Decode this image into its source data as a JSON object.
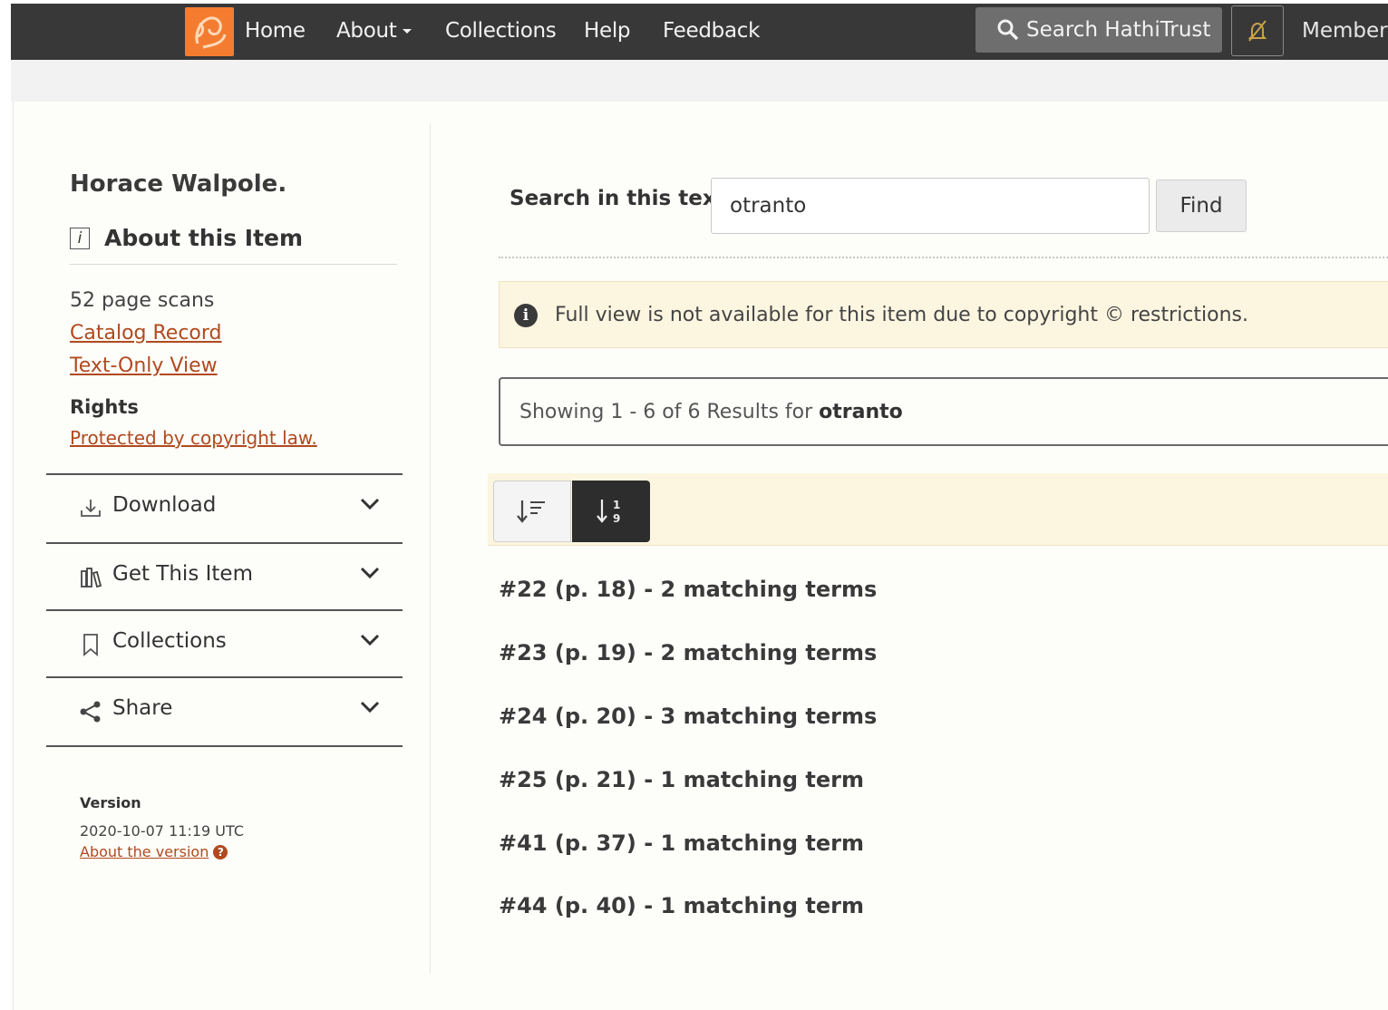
{
  "nav": {
    "home": "Home",
    "about": "About",
    "collections": "Collections",
    "help": "Help",
    "feedback": "Feedback",
    "search_button": "Search HathiTrust",
    "member": "Member"
  },
  "sidebar": {
    "author": "Horace Walpole.",
    "about_heading": "About this Item",
    "page_scans": "52 page scans",
    "catalog_record": "Catalog Record",
    "text_only_view": "Text-Only View",
    "rights_label": "Rights",
    "rights_link": "Protected by copyright law.",
    "accordion": [
      {
        "label": "Download",
        "icon": "download-icon"
      },
      {
        "label": "Get This Item",
        "icon": "library-icon"
      },
      {
        "label": "Collections",
        "icon": "bookmark-icon"
      },
      {
        "label": "Share",
        "icon": "share-icon"
      }
    ],
    "version_label": "Version",
    "version_date": "2020-10-07 11:19 UTC",
    "version_link": "About the version"
  },
  "main": {
    "search_label": "Search in this text",
    "search_value": "otranto",
    "find_button": "Find",
    "alert": "Full view is not available for this item due to copyright © restrictions.",
    "results_prefix": "Showing 1 - 6 of 6 Results for",
    "results_term": "otranto",
    "results": [
      "#22 (p. 18) - 2 matching terms",
      "#23 (p. 19) - 2 matching terms",
      "#24 (p. 20) - 3 matching terms",
      "#25 (p. 21) - 1 matching term",
      "#41 (p. 37) - 1 matching term",
      "#44 (p. 40) - 1 matching term"
    ]
  },
  "colors": {
    "nav_bg": "#383838",
    "logo": "#f47c30",
    "link": "#b04a1e",
    "alert_bg": "#fcf5e0"
  }
}
